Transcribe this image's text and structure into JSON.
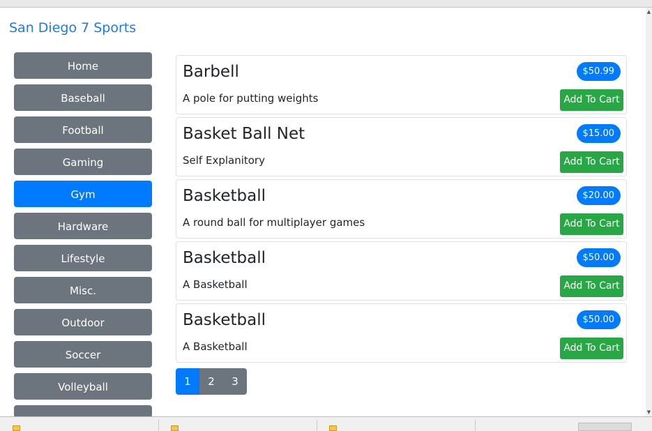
{
  "brand": "San Diego 7 Sports",
  "sidebar": {
    "categories": [
      "Home",
      "Baseball",
      "Football",
      "Gaming",
      "Gym",
      "Hardware",
      "Lifestyle",
      "Misc.",
      "Outdoor",
      "Soccer",
      "Volleyball"
    ],
    "active": "Gym"
  },
  "products": [
    {
      "name": "Barbell",
      "price": "$50.99",
      "description": "A pole for putting weights",
      "button": "Add To Cart"
    },
    {
      "name": "Basket Ball Net",
      "price": "$15.00",
      "description": "Self Explanitory",
      "button": "Add To Cart"
    },
    {
      "name": "Basketball",
      "price": "$20.00",
      "description": "A round ball for multiplayer games",
      "button": "Add To Cart"
    },
    {
      "name": "Basketball",
      "price": "$50.00",
      "description": "A Basketball",
      "button": "Add To Cart"
    },
    {
      "name": "Basketball",
      "price": "$50.00",
      "description": "A Basketball",
      "button": "Add To Cart"
    }
  ],
  "pagination": {
    "pages": [
      "1",
      "2",
      "3"
    ],
    "current": "1"
  },
  "colors": {
    "primary": "#007bff",
    "secondary": "#6c757d",
    "success": "#28a745",
    "brand": "#1e7be0"
  }
}
